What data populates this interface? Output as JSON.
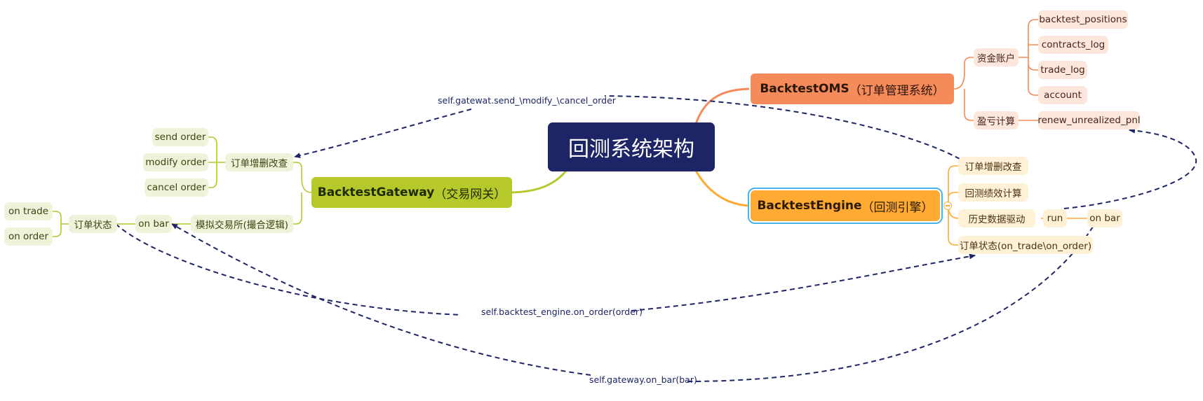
{
  "central": "回测系统架构",
  "oms": {
    "title": "BacktestOMS",
    "subtitle": "（订单管理系统）",
    "account_group": "资金账户",
    "account_items": [
      "backtest_positions",
      "contracts_log",
      "trade_log",
      "account"
    ],
    "pnl_group": "盈亏计算",
    "pnl_item": "renew_unrealized_pnl"
  },
  "gateway": {
    "title": "BacktestGateway",
    "subtitle": "（交易网关）",
    "order_group": "订单增删改查",
    "order_items": [
      "send order",
      "modify order",
      "cancel order"
    ],
    "exchange": "模拟交易所(撮合逻辑)",
    "on_bar": "on bar",
    "order_status": "订单状态",
    "status_items": [
      "on trade",
      "on order"
    ]
  },
  "engine": {
    "title": "BacktestEngine",
    "subtitle": "（回测引擎）",
    "items": [
      "订单增删改查",
      "回测绩效计算",
      "历史数据驱动",
      "订单状态(on_trade\\on_order)"
    ],
    "run": "run",
    "on_bar": "on bar"
  },
  "relations": {
    "send_modify_cancel": "self.gatewat.send_\\modify_\\cancel_order",
    "engine_on_order": "self.backtest_engine.on_order(order)",
    "gateway_on_bar": "self.gateway.on_bar(bar)"
  },
  "colors": {
    "central": "#1e2566",
    "oms": "#f58a5a",
    "gateway": "#b6c82a",
    "engine": "#ffaa33",
    "selection": "#48b3e8",
    "relation": "#1e2566"
  }
}
